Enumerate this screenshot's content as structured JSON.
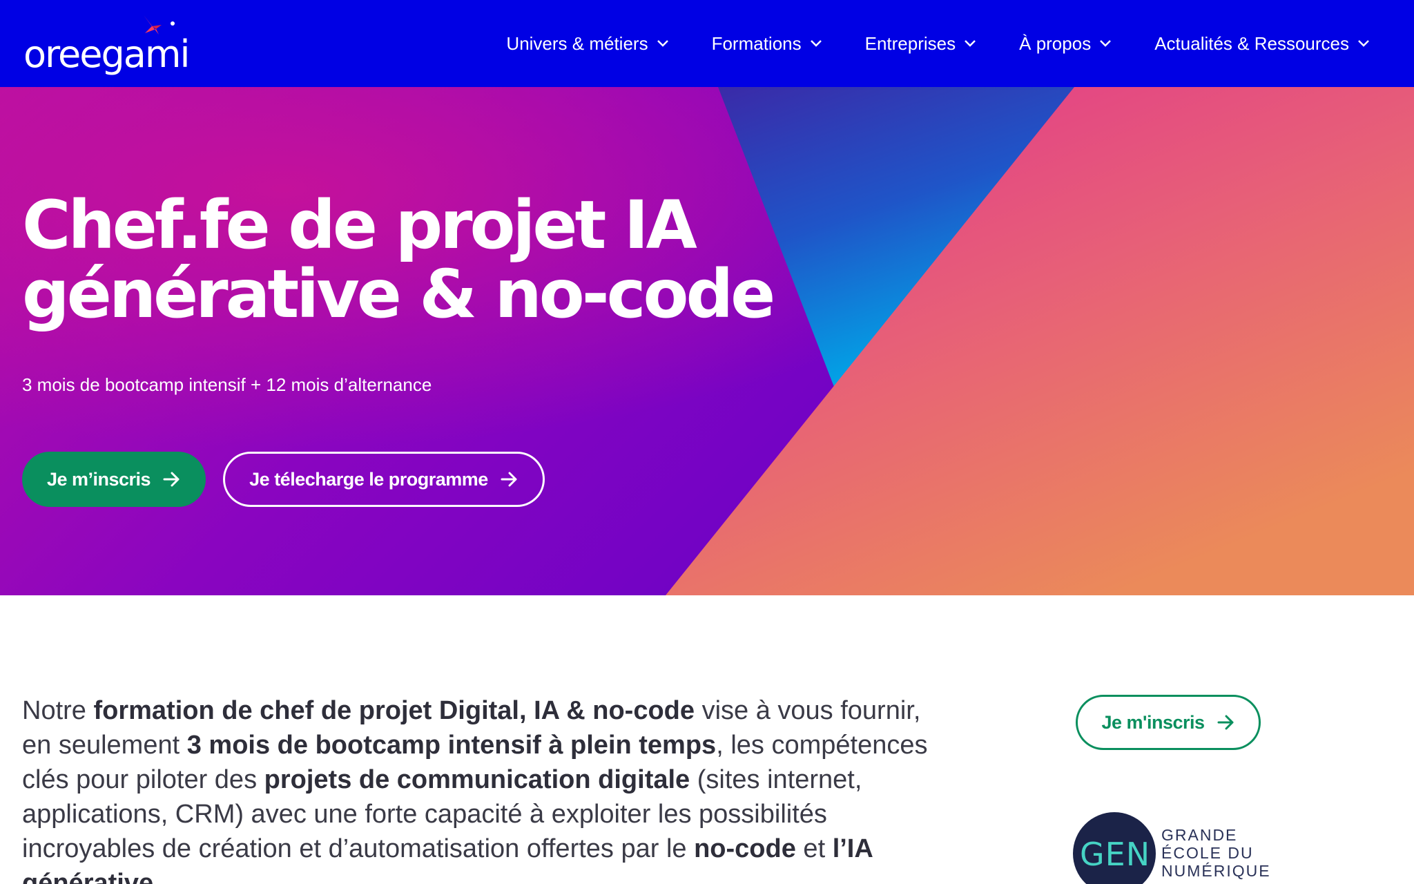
{
  "brand": {
    "logo_text": "oreegami"
  },
  "nav": {
    "items": [
      {
        "label": "Univers & métiers"
      },
      {
        "label": "Formations"
      },
      {
        "label": "Entreprises"
      },
      {
        "label": "À propos"
      },
      {
        "label": "Actualités & Ressources"
      }
    ]
  },
  "hero": {
    "title_line1": "Chef.fe de projet IA",
    "title_line2": "générative & no-code",
    "subtitle": "3 mois de bootcamp intensif + 12 mois d’alternance",
    "primary_button": "Je m’inscris",
    "secondary_button": "Je télecharge le programme"
  },
  "intro": {
    "t1": "Notre ",
    "b1": "formation de chef de projet Digital, IA & no-code",
    "t2": " vise à vous fournir, en seulement ",
    "b2": "3 mois de bootcamp intensif à plein temps",
    "t3": ", les compétences clés pour piloter des ",
    "b3": "projets de communication digitale",
    "t4": " (sites internet, applications, CRM) avec une forte capacité à exploiter les possibilités incroyables de création et d’automatisation offertes par le ",
    "b4": "no-code",
    "t5": " et ",
    "b5": "l’IA générative",
    "t6": "."
  },
  "sidebar": {
    "signup_button": "Je m'inscris",
    "gen_logo": {
      "mark": "GEN",
      "line1": "GRANDE",
      "line2": "ÉCOLE DU",
      "line3": "NUMÉRIQUE"
    }
  },
  "colors": {
    "header_bg": "#0000e4",
    "primary_green": "#0a8f5e",
    "hero_purple": "#8a05c0",
    "hero_pink": "#e0457e",
    "hero_cyan": "#0aa6e0"
  }
}
